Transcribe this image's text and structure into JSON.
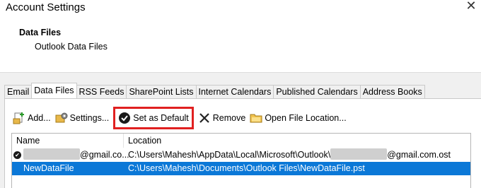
{
  "window": {
    "title": "Account Settings",
    "close_glyph": "✕"
  },
  "header": {
    "section_title": "Data Files",
    "section_subtitle": "Outlook Data Files"
  },
  "tabs": [
    {
      "label": "Email"
    },
    {
      "label": "Data Files",
      "active": true
    },
    {
      "label": "RSS Feeds"
    },
    {
      "label": "SharePoint Lists"
    },
    {
      "label": "Internet Calendars"
    },
    {
      "label": "Published Calendars"
    },
    {
      "label": "Address Books"
    }
  ],
  "toolbar": {
    "add_label": "Add...",
    "settings_label": "Settings...",
    "set_default_label": "Set as Default",
    "remove_label": "Remove",
    "open_location_label": "Open File Location..."
  },
  "table": {
    "columns": [
      "Name",
      "Location"
    ],
    "rows": [
      {
        "name": "@gmail.co...",
        "location_prefix": "C:\\Users\\Mahesh\\AppData\\Local\\Microsoft\\Outlook\\",
        "location_suffix": "@gmail.com.ost",
        "is_default": true
      },
      {
        "name": "NewDataFile",
        "location": "C:\\Users\\Mahesh\\Documents\\Outlook Files\\NewDataFile.pst",
        "selected": true
      }
    ]
  },
  "colors": {
    "selection": "#0b78d7",
    "highlight_box": "#e02020"
  }
}
